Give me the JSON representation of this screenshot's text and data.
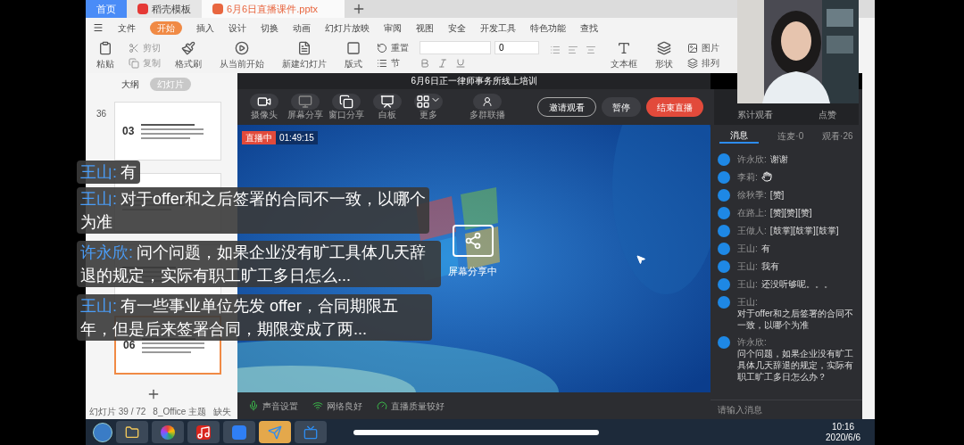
{
  "wps": {
    "tabs": [
      {
        "label": "首页",
        "kind": "home",
        "selected": false
      },
      {
        "label": "稻壳模板",
        "kind": "docer",
        "selected": false
      },
      {
        "label": "6月6日直播课件.pptx",
        "kind": "file",
        "selected": true
      }
    ],
    "menu": [
      {
        "label": "文件",
        "selected": false
      },
      {
        "label": "开始",
        "selected": true
      },
      {
        "label": "插入",
        "selected": false
      },
      {
        "label": "设计",
        "selected": false
      },
      {
        "label": "切换",
        "selected": false
      },
      {
        "label": "动画",
        "selected": false
      },
      {
        "label": "幻灯片放映",
        "selected": false
      },
      {
        "label": "审阅",
        "selected": false
      },
      {
        "label": "视图",
        "selected": false
      },
      {
        "label": "安全",
        "selected": false
      },
      {
        "label": "开发工具",
        "selected": false
      },
      {
        "label": "特色功能",
        "selected": false
      },
      {
        "label": "查找",
        "selected": false
      }
    ],
    "ribbon": {
      "paste": "粘贴",
      "cut": "剪切",
      "copy": "复制",
      "format_painter": "格式刷",
      "play_from_current": "从当前开始",
      "new_slide": "新建幻灯片",
      "layout": "版式",
      "reset": "重置",
      "section": "节",
      "font_size": "0",
      "text_box": "文本框",
      "shape": "形状",
      "picture": "图片",
      "arrange": "排列"
    },
    "panel_tabs": [
      {
        "label": "大纲",
        "selected": false
      },
      {
        "label": "幻灯片",
        "selected": true
      }
    ],
    "slides": [
      {
        "number": "36",
        "section": "03",
        "selected": false
      },
      {
        "selected": false
      },
      {
        "selected": false
      },
      {
        "section": "06",
        "selected": true
      }
    ],
    "status_bar": {
      "slide_count": "幻灯片 39 / 72",
      "theme": "8_Office 主题",
      "missing_font": "缺失"
    }
  },
  "live": {
    "title": "6月6日正一律师事务所线上培训",
    "tools": [
      {
        "label": "摄像头",
        "kind": "camera"
      },
      {
        "label": "屏幕分享",
        "kind": "screen"
      },
      {
        "label": "窗口分享",
        "kind": "window"
      },
      {
        "label": "白板",
        "kind": "whiteboard"
      },
      {
        "label": "更多",
        "kind": "more"
      }
    ],
    "multi_group": "多群联播",
    "invite": "邀请观看",
    "pause": "暂停",
    "end": "结束直播",
    "live_badge": "直播中",
    "elapsed": "01:49:15",
    "sharing": "屏幕分享中",
    "status": [
      {
        "label": "声音设置",
        "kind": "mic"
      },
      {
        "label": "网络良好",
        "kind": "wifi"
      },
      {
        "label": "直播质量较好",
        "kind": "quality"
      }
    ],
    "stats": [
      "累计观看",
      "点赞"
    ],
    "chat_tabs": [
      {
        "label": "消息",
        "selected": true
      },
      {
        "label": "连麦·0",
        "selected": false
      },
      {
        "label": "观看·26",
        "selected": false
      }
    ],
    "messages": [
      {
        "name": "许永欣:",
        "kind": "text",
        "text": "谢谢"
      },
      {
        "name": "李莉:",
        "kind": "emoji"
      },
      {
        "name": "徐秋季:",
        "kind": "text",
        "text": "[赞]"
      },
      {
        "name": "在路上:",
        "kind": "text",
        "text": "[赞][赞][赞]"
      },
      {
        "name": "王做人:",
        "kind": "text",
        "text": "[鼓掌][鼓掌][鼓掌]"
      },
      {
        "name": "王山:",
        "kind": "text",
        "text": "有"
      },
      {
        "name": "王山:",
        "kind": "text",
        "text": "我有"
      },
      {
        "name": "王山:",
        "kind": "text",
        "text": "还没听够呢。。。"
      },
      {
        "name": "王山:",
        "kind": "text",
        "text": "对于offer和之后签署的合同不一致，以哪个为准"
      },
      {
        "name": "许永欣:",
        "kind": "text",
        "text": "问个问题，如果企业没有旷工具体几天辞退的规定，实际有职工旷工多日怎么办？"
      }
    ],
    "input_placeholder": "请输入消息"
  },
  "bullet_comments": [
    {
      "name": "王山:",
      "text": "有"
    },
    {
      "name": "王山:",
      "text": "对于offer和之后签署的合同不一致，以哪个为准"
    },
    {
      "name": "许永欣:",
      "text": "问个问题，如果企业没有旷工具体几天辞退的规定，实际有职工旷工多日怎么..."
    },
    {
      "name": "王山:",
      "text": "有一些事业单位先发 offer，合同期限五年，但是后来签署合同，期限变成了两..."
    }
  ],
  "taskbar": {
    "apps": [
      {
        "kind": "explorer",
        "selected": false
      },
      {
        "kind": "chrome",
        "selected": false
      },
      {
        "kind": "music",
        "selected": false
      },
      {
        "kind": "wps",
        "selected": false
      },
      {
        "kind": "feishu",
        "selected": true
      },
      {
        "kind": "live",
        "selected": false
      }
    ],
    "time": "10:16",
    "date": "2020/6/6"
  }
}
